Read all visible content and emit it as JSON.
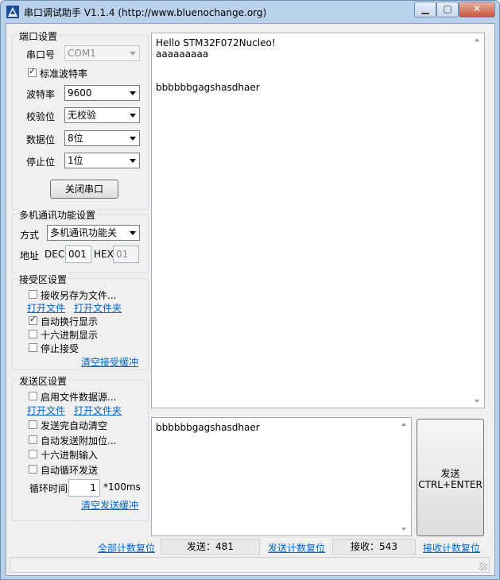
{
  "window": {
    "title": "串口调试助手 V1.1.4 (http://www.bluenochange.org)"
  },
  "port_settings": {
    "group_title": "端口设置",
    "port_label": "串口号",
    "port_value": "COM1",
    "standard_baud_label": "标准波特率",
    "standard_baud_checked": true,
    "baud_label": "波特率",
    "baud_value": "9600",
    "parity_label": "校验位",
    "parity_value": "无校验",
    "databits_label": "数据位",
    "databits_value": "8位",
    "stopbits_label": "停止位",
    "stopbits_value": "1位",
    "close_button": "关闭串口"
  },
  "multi_machine": {
    "group_title": "多机通讯功能设置",
    "mode_label": "方式",
    "mode_value": "多机通讯功能关",
    "address_label": "地址",
    "dec_label": "DEC",
    "dec_value": "001",
    "hex_label": "HEX",
    "hex_value": "01"
  },
  "receive_settings": {
    "group_title": "接受区设置",
    "save_to_file_label": "接收另存为文件...",
    "save_to_file_checked": false,
    "open_file": "打开文件",
    "open_folder": "打开文件夹",
    "auto_wrap_label": "自动换行显示",
    "auto_wrap_checked": true,
    "hex_display_label": "十六进制显示",
    "hex_display_checked": false,
    "stop_receive_label": "停止接受",
    "stop_receive_checked": false,
    "clear_buffer": "清空接受缓冲"
  },
  "send_settings": {
    "group_title": "发送区设置",
    "file_source_label": "启用文件数据源...",
    "file_source_checked": false,
    "open_file": "打开文件",
    "open_folder": "打开文件夹",
    "auto_clear_label": "发送完自动清空",
    "auto_clear_checked": false,
    "append_label": "自动发送附加位...",
    "append_checked": false,
    "hex_input_label": "十六进制输入",
    "hex_input_checked": false,
    "loop_send_label": "自动循环发送",
    "loop_send_checked": false,
    "interval_label": "循环时间",
    "interval_value": "1",
    "interval_unit": "*100ms",
    "clear_buffer": "清空发送缓冲"
  },
  "receive_area": {
    "lines": [
      "Hello STM32F072Nucleo!",
      "aaaaaaaaa",
      "",
      "",
      "bbbbbbgagshasdhaer"
    ]
  },
  "send_area": {
    "text": "bbbbbbgagshasdhaer"
  },
  "send_button": {
    "line1": "发送",
    "line2": "CTRL+ENTER"
  },
  "counters": {
    "reset_all": "全部计数复位",
    "sent_label": "发送：",
    "sent_value": "481",
    "reset_sent": "发送计数复位",
    "recv_label": "接收：",
    "recv_value": "543",
    "reset_recv": "接收计数复位"
  }
}
